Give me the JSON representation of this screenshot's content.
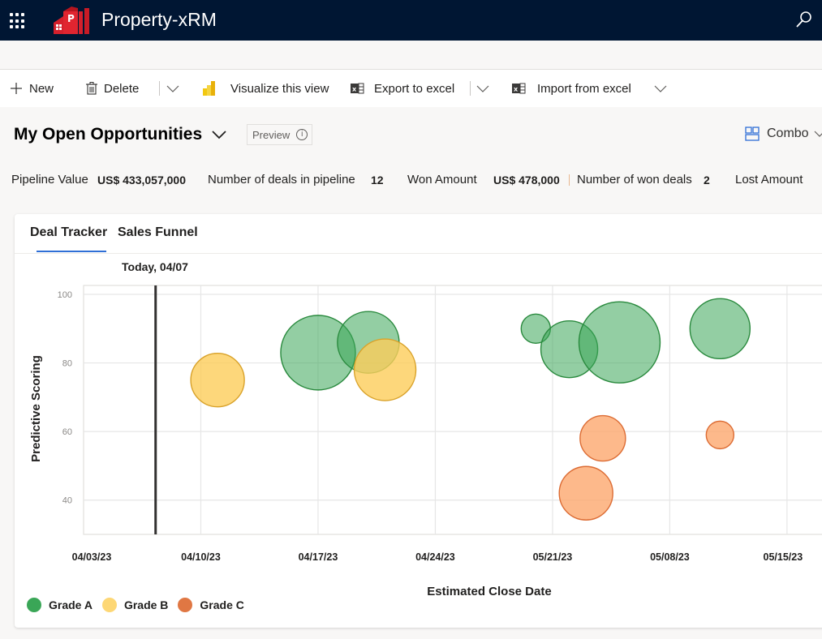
{
  "app": {
    "title": "Property-xRM",
    "logo_letter": "P"
  },
  "toolbar": {
    "new_label": "New",
    "delete_label": "Delete",
    "visualize_label": "Visualize this view",
    "export_label": "Export to excel",
    "import_label": "Import from excel"
  },
  "view": {
    "title": "My Open Opportunities",
    "preview_label": "Preview",
    "chart_type_label": "Combo"
  },
  "kpis": {
    "pipeline_value_label": "Pipeline Value",
    "pipeline_value": "US$ 433,057,000",
    "deals_in_pipeline_label": "Number of deals in pipeline",
    "deals_in_pipeline": "12",
    "won_amount_label": "Won Amount",
    "won_amount": "US$ 478,000",
    "won_deals_label": "Number of won deals",
    "won_deals": "2",
    "lost_amount_label": "Lost Amount"
  },
  "tabs": [
    {
      "label": "Deal Tracker",
      "active": true
    },
    {
      "label": "Sales Funnel",
      "active": false
    }
  ],
  "colors": {
    "topbar": "#001633",
    "accent": "#2f6fd6",
    "grade_a": "#3aa657",
    "grade_b": "#fdd775",
    "grade_c": "#e07743"
  },
  "chart_data": {
    "type": "scatter",
    "subtype": "bubble",
    "title": "",
    "annotation": "Today, 04/07",
    "annotation_x_day": 4.3,
    "xlabel": "Estimated Close Date",
    "ylabel": "Predictive Scoring",
    "x_tick_labels": [
      "04/03/23",
      "04/10/23",
      "04/17/23",
      "04/24/23",
      "05/21/23",
      "05/08/23",
      "05/15/23"
    ],
    "x_ticks_day": [
      0,
      7,
      14,
      21,
      28,
      35,
      42
    ],
    "xlim_day": [
      0,
      44
    ],
    "ylim": [
      30,
      102.6
    ],
    "y_ticks": [
      40,
      60,
      80,
      100
    ],
    "grid": true,
    "legend": {
      "position": "bottom-left",
      "entries": [
        "Grade A",
        "Grade B",
        "Grade C"
      ]
    },
    "series": [
      {
        "name": "Grade A",
        "points": [
          {
            "day": 14,
            "score": 83,
            "size": 46
          },
          {
            "day": 17,
            "score": 86,
            "size": 38
          },
          {
            "day": 27,
            "score": 90,
            "size": 18
          },
          {
            "day": 29,
            "score": 84,
            "size": 35
          },
          {
            "day": 32,
            "score": 86,
            "size": 50
          },
          {
            "day": 38,
            "score": 90,
            "size": 37
          }
        ]
      },
      {
        "name": "Grade B",
        "points": [
          {
            "day": 8,
            "score": 75,
            "size": 33
          },
          {
            "day": 18,
            "score": 78,
            "size": 38
          }
        ]
      },
      {
        "name": "Grade C",
        "points": [
          {
            "day": 31,
            "score": 58,
            "size": 28
          },
          {
            "day": 30,
            "score": 42,
            "size": 33
          },
          {
            "day": 38,
            "score": 59,
            "size": 17
          }
        ]
      }
    ]
  }
}
